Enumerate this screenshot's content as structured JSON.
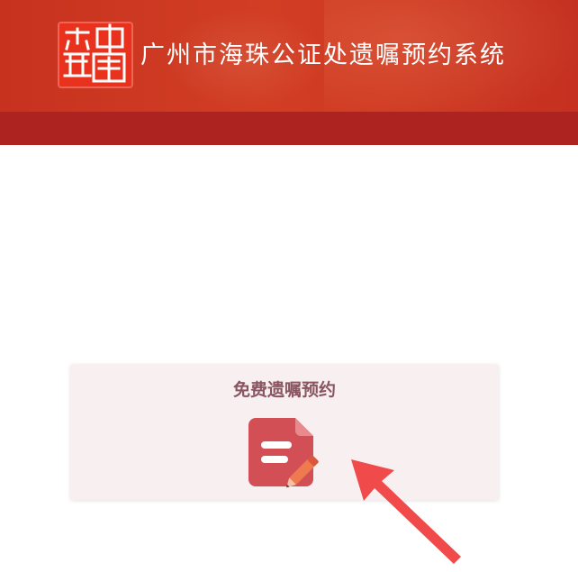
{
  "header": {
    "title": "广州市海珠公证处遗嘱预约系统",
    "logo_icon": "notary-seal-logo",
    "colors": {
      "primary": "#d13e24",
      "band": "#ad2320"
    }
  },
  "card": {
    "title": "免费遗嘱预约",
    "icon": "document-edit-icon",
    "colors": {
      "background": "#f8eff1",
      "title": "#8a5560",
      "icon": "#d14f55"
    }
  },
  "annotation": {
    "icon": "red-arrow-pointer",
    "color": "#f04a4a"
  }
}
